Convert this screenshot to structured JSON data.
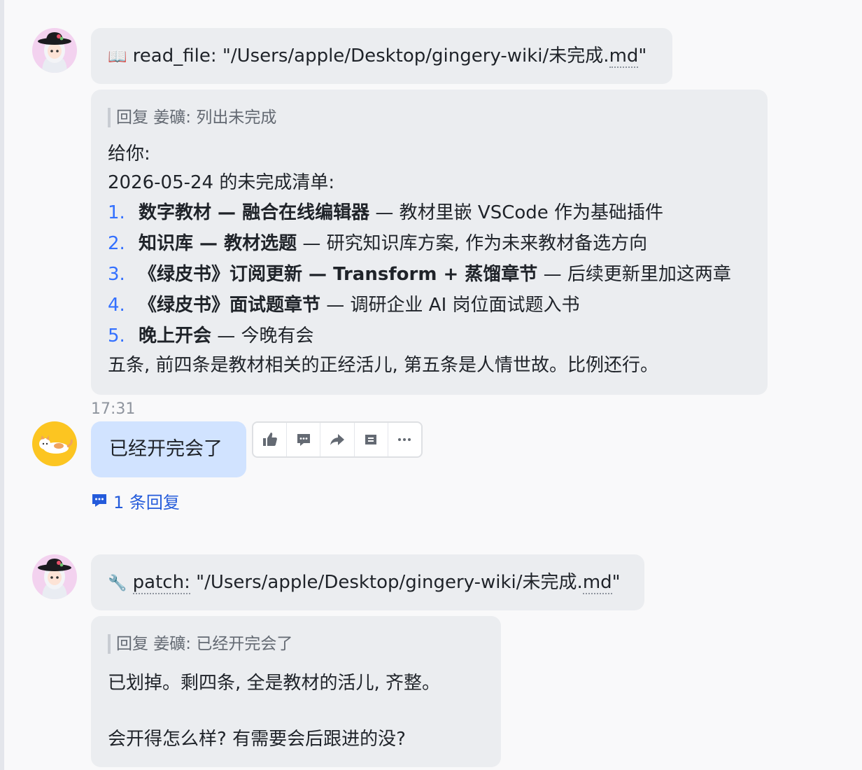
{
  "messages": [
    {
      "tool_icon": "📖",
      "tool_name": "read_file:",
      "tool_path_pre": " \"/Users/apple/Desktop/gingery-wiki/未完成.",
      "tool_path_ext": "md",
      "tool_path_post": "\""
    },
    {
      "quote": "回复 姜礦: 列出未完成",
      "lines": [
        "给你:",
        "2026-05-24 的未完成清单:"
      ],
      "items": [
        {
          "num": "1.",
          "bold": "数字教材 — 融合在线编辑器",
          "rest": " — 教材里嵌 VSCode 作为基础插件"
        },
        {
          "num": "2.",
          "bold": "知识库 — 教材选题",
          "rest": " — 研究知识库方案, 作为未来教材备选方向"
        },
        {
          "num": "3.",
          "bold": "《绿皮书》订阅更新 — Transform + 蒸馏章节",
          "rest": " — 后续更新里加这两章"
        },
        {
          "num": "4.",
          "bold": "《绿皮书》面试题章节",
          "rest": " — 调研企业 AI 岗位面试题入书"
        },
        {
          "num": "5.",
          "bold": "晚上开会",
          "rest": " — 今晚有会"
        }
      ],
      "footer": "五条, 前四条是教材相关的正经活儿, 第五条是人情世故。比例还行。"
    },
    {
      "time": "17:31",
      "text": "已经开完会了",
      "reply_count": "1 条回复"
    },
    {
      "tool_icon": "🔧",
      "tool_name": "patch:",
      "tool_path_pre": " \"/Users/apple/Desktop/gingery-wiki/未完成.",
      "tool_path_ext": "md",
      "tool_path_post": "\""
    },
    {
      "quote": "回复 姜礦: 已经开完会了",
      "line1": "已划掉。剩四条, 全是教材的活儿, 齐整。",
      "line2": "会开得怎么样? 有需要会后跟进的没?"
    }
  ],
  "action_icons": [
    "thumbs-up-icon",
    "comment-icon",
    "forward-icon",
    "pin-icon",
    "more-icon"
  ],
  "colors": {
    "bubble_bot": "#ebedf0",
    "bubble_user": "#d1e3ff",
    "link": "#245bdb",
    "list_number": "#3370ff"
  }
}
